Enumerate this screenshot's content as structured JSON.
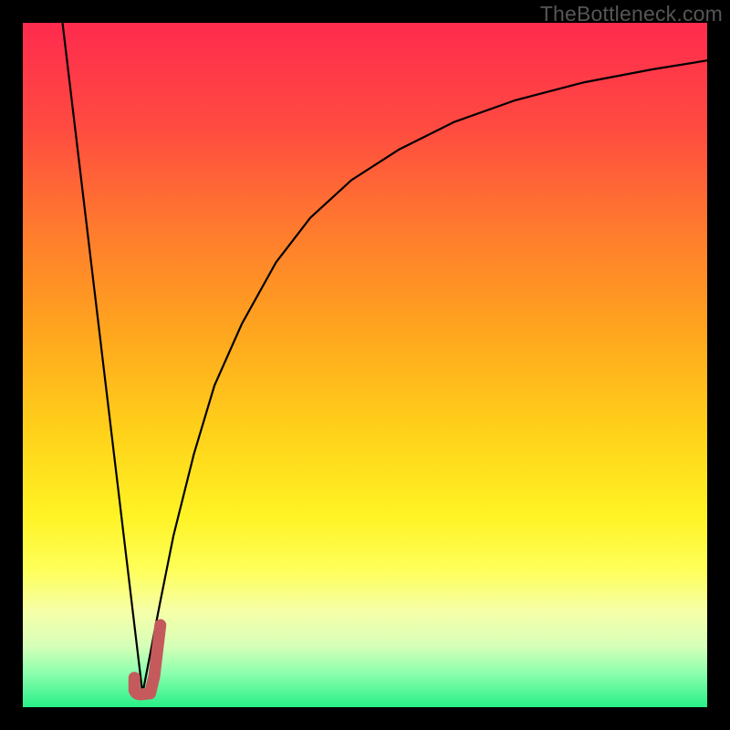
{
  "watermark": {
    "text": "TheBottleneck.com"
  },
  "colors": {
    "black": "#000000",
    "marker": "#c45a5c",
    "gradient_stops": [
      {
        "offset": 0.0,
        "color": "#ff2b4e"
      },
      {
        "offset": 0.15,
        "color": "#ff4a41"
      },
      {
        "offset": 0.3,
        "color": "#ff7a2e"
      },
      {
        "offset": 0.45,
        "color": "#ffa51e"
      },
      {
        "offset": 0.6,
        "color": "#ffd21a"
      },
      {
        "offset": 0.72,
        "color": "#fff324"
      },
      {
        "offset": 0.8,
        "color": "#feff5a"
      },
      {
        "offset": 0.86,
        "color": "#f6ffa8"
      },
      {
        "offset": 0.91,
        "color": "#d7ffb8"
      },
      {
        "offset": 0.95,
        "color": "#8dffae"
      },
      {
        "offset": 1.0,
        "color": "#27ef87"
      }
    ]
  },
  "chart_data": {
    "type": "line",
    "title": "",
    "xlabel": "",
    "ylabel": "",
    "xlim": [
      0,
      100
    ],
    "ylim": [
      0,
      100
    ],
    "series": [
      {
        "name": "left-spike",
        "x": [
          5.8,
          17.5
        ],
        "values": [
          100,
          2
        ]
      },
      {
        "name": "right-asymptote",
        "x": [
          17.5,
          20,
          22,
          25,
          28,
          32,
          37,
          42,
          48,
          55,
          63,
          72,
          82,
          92,
          100
        ],
        "values": [
          2,
          15,
          25,
          37,
          47,
          56,
          65,
          71.5,
          77,
          81.5,
          85.5,
          88.7,
          91.3,
          93.2,
          94.5
        ]
      }
    ],
    "marker": {
      "name": "J-marker",
      "points_x": [
        16.3,
        16.3,
        17.5,
        18.6,
        19.2,
        20.1
      ],
      "points_y": [
        4.3,
        2.5,
        1.9,
        2.0,
        4.5,
        12.0
      ]
    },
    "legend": []
  }
}
